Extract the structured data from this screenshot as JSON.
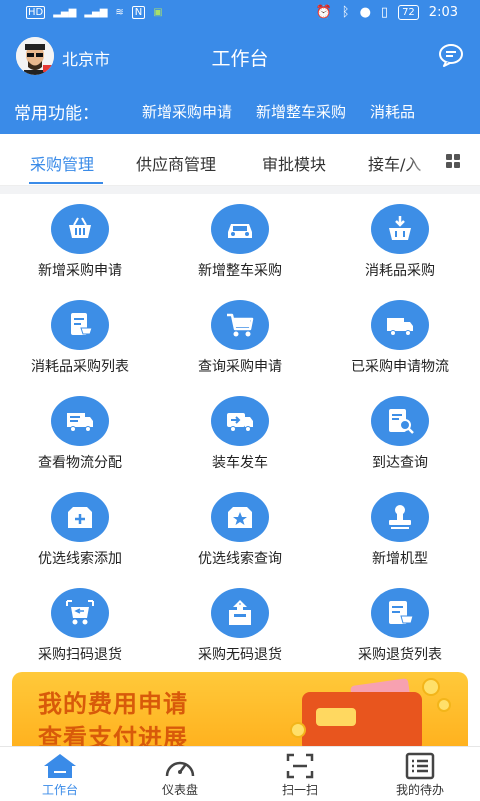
{
  "status_bar": {
    "left_items": [
      "HD",
      "5G",
      "2G",
      "wifi",
      "N",
      "android"
    ],
    "battery": "72",
    "time": "2:03"
  },
  "header": {
    "city": "北京市",
    "title": "工作台"
  },
  "quick_functions": {
    "label": "常用功能：",
    "items": [
      "新增采购申请",
      "新增整车采购",
      "消耗品"
    ]
  },
  "tabs": [
    "采购管理",
    "供应商管理",
    "审批模块",
    "接车/入"
  ],
  "active_tab": 0,
  "grid_items": [
    {
      "label": "新增采购申请",
      "icon": "basket-icon"
    },
    {
      "label": "新增整车采购",
      "icon": "car-icon"
    },
    {
      "label": "消耗品采购",
      "icon": "download-basket-icon"
    },
    {
      "label": "消耗品采购列表",
      "icon": "cart-list-icon"
    },
    {
      "label": "查询采购申请",
      "icon": "cart-icon"
    },
    {
      "label": "已采购申请物流",
      "icon": "truck-icon"
    },
    {
      "label": "查看物流分配",
      "icon": "truck-list-icon"
    },
    {
      "label": "装车发车",
      "icon": "loading-truck-icon"
    },
    {
      "label": "到达查询",
      "icon": "search-document-icon"
    },
    {
      "label": "优选线索添加",
      "icon": "add-box-icon"
    },
    {
      "label": "优选线索查询",
      "icon": "star-box-icon"
    },
    {
      "label": "新增机型",
      "icon": "stamp-icon"
    },
    {
      "label": "采购扫码退货",
      "icon": "scan-cart-icon"
    },
    {
      "label": "采购无码退货",
      "icon": "return-box-icon"
    },
    {
      "label": "采购退货列表",
      "icon": "return-list-icon"
    }
  ],
  "banner": {
    "line1": "我的费用申请",
    "line2": "查看支付进展"
  },
  "bottom_nav": [
    {
      "label": "工作台",
      "icon": "home-icon"
    },
    {
      "label": "仪表盘",
      "icon": "dashboard-icon"
    },
    {
      "label": "扫一扫",
      "icon": "scan-icon"
    },
    {
      "label": "我的待办",
      "icon": "todo-list-icon"
    }
  ],
  "colors": {
    "primary": "#3a8be8",
    "banner": "#ffc02e",
    "banner_text": "#d85a0a"
  }
}
